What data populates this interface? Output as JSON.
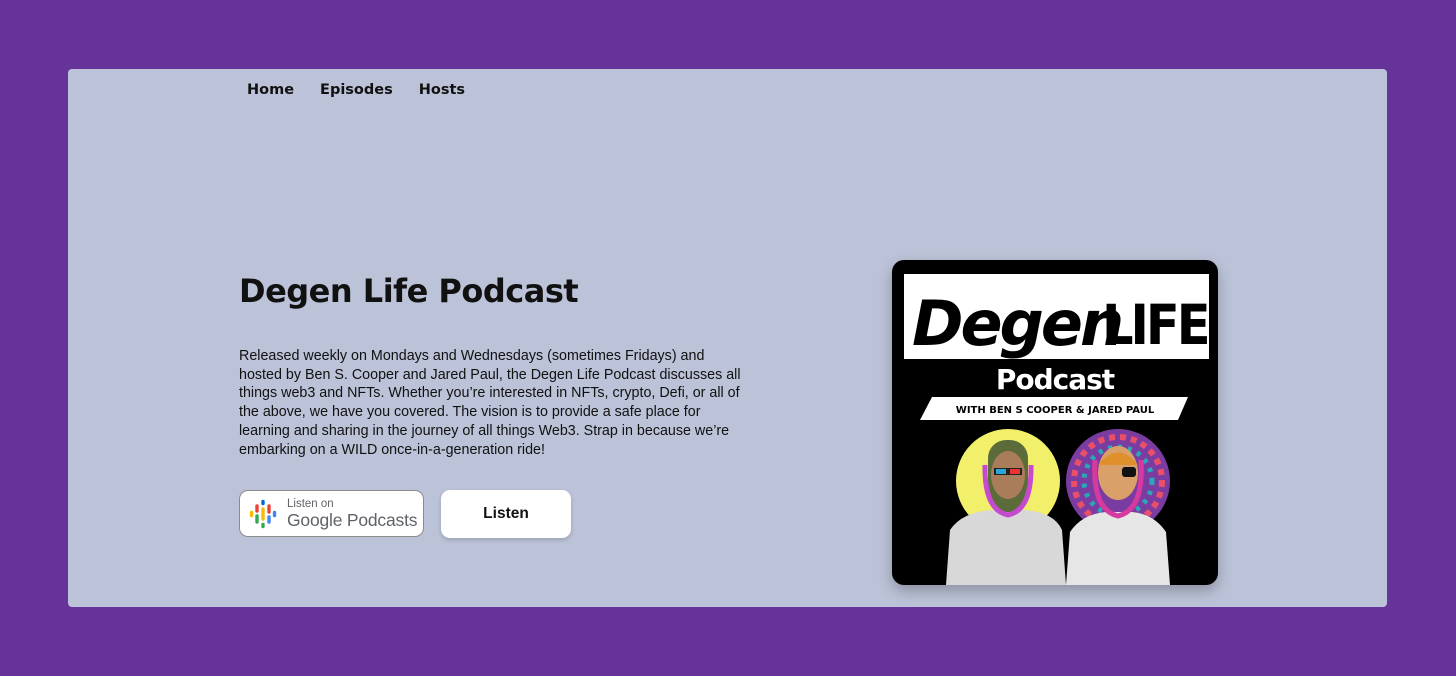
{
  "nav": {
    "items": [
      {
        "label": "Home"
      },
      {
        "label": "Episodes"
      },
      {
        "label": "Hosts"
      }
    ]
  },
  "hero": {
    "title": "Degen Life Podcast",
    "description": "Released weekly on Mondays and Wednesdays (sometimes Fridays) and hosted by Ben S. Cooper and Jared Paul, the Degen Life Podcast discusses all things web3 and NFTs. Whether you’re interested in NFTs, crypto, Defi, or all of the above, we have you covered. The vision is to provide a safe place for learning and sharing in the journey of all things Web3. Strap in because we’re embarking on a WILD once-in-a-generation ride!"
  },
  "buttons": {
    "google_podcasts_small": "Listen on",
    "google_podcasts_big": "Google Podcasts",
    "listen_label": "Listen"
  },
  "cover_art": {
    "word_degen": "Degen",
    "word_life": "LIFE",
    "word_podcast": "Podcast",
    "hosts_banner": "WITH BEN S COOPER & JARED PAUL"
  },
  "colors": {
    "page_background": "#663399",
    "card_background": "#bcc3d8",
    "cover_background": "#000000",
    "host_left_halo": "#f2f06a",
    "host_right_halo": "#7a3ca0"
  },
  "icons": {
    "google_podcasts_logo": "google-podcasts-icon"
  }
}
